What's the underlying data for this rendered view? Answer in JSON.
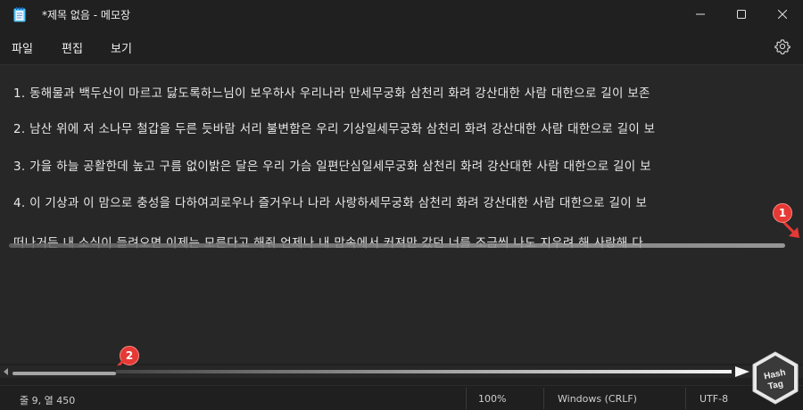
{
  "window": {
    "title": "*제목 없음 - 메모장"
  },
  "menu": {
    "file": "파일",
    "edit": "편집",
    "view": "보기"
  },
  "editor": {
    "lines": [
      "1. 동해물과 백두산이 마르고 닳도록하느님이 보우하사 우리나라 만세무궁화 삼천리 화려 강산대한 사람 대한으로 길이 보존",
      "2. 남산 위에 저 소나무 철갑을 두른 듯바람 서리 불변함은 우리 기상일세무궁화 삼천리 화려 강산대한 사람 대한으로 길이 보",
      "3. 가을 하늘 공활한데 높고 구름 없이밝은 달은 우리 가슴 일편단심일세무궁화 삼천리 화려 강산대한 사람 대한으로 길이 보",
      "4. 이 기상과 이 맘으로 충성을 다하여괴로우나 즐거우나 나라 사랑하세무궁화 삼천리 화려 강산대한 사람 대한으로 길이 보",
      "떠나거든 내 소식이 들려오면 이제는 모른다고 해줘 언제나 내 맘속에서 커져만 갔던 너를 조금씩 나도 지우려 해 사랑해 다"
    ]
  },
  "annotations": {
    "badge1": "1",
    "badge2": "2",
    "color": "#e53935"
  },
  "status": {
    "position": "줄 9, 열 450",
    "zoom": "100%",
    "line_ending": "Windows (CRLF)",
    "encoding": "UTF-8"
  },
  "logo": {
    "text1": "Hash",
    "text2": "Tag"
  }
}
